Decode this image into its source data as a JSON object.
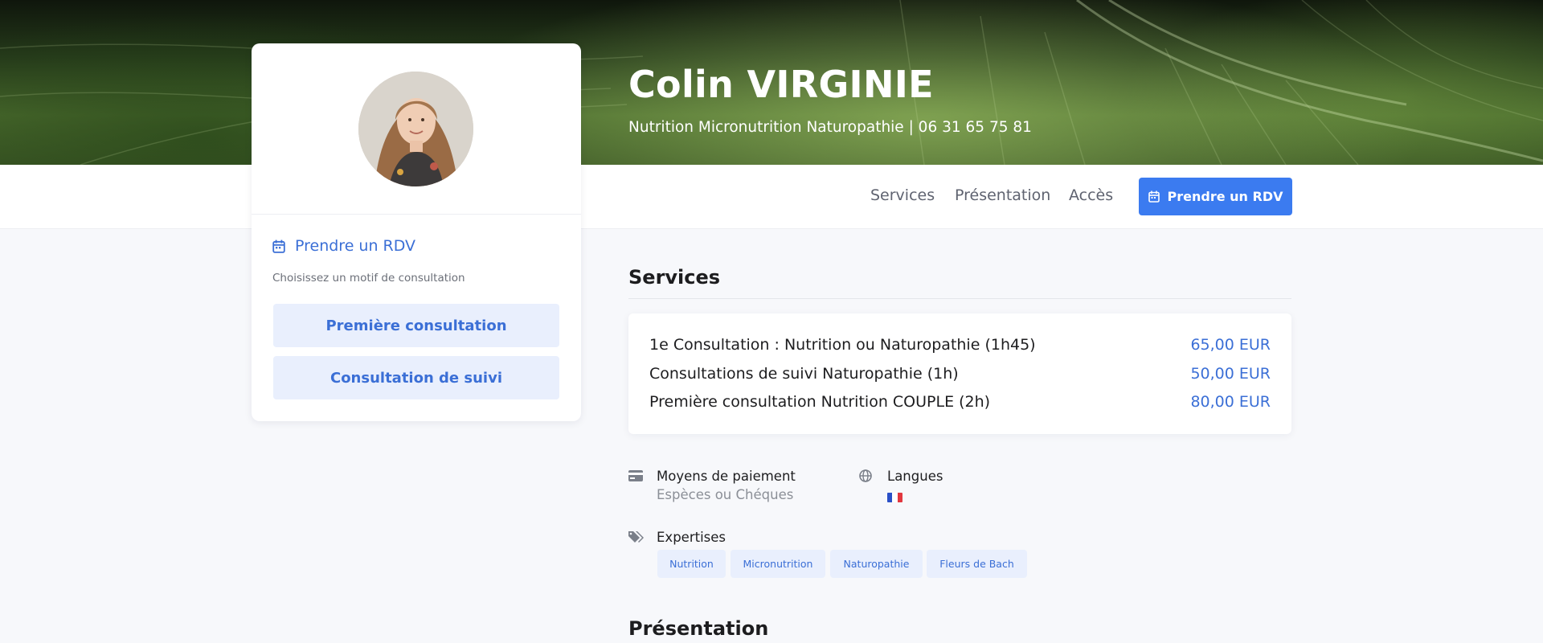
{
  "header": {
    "name": "Colin VIRGINIE",
    "subtitle": "Nutrition Micronutrition Naturopathie | 06 31 65 75 81"
  },
  "nav": {
    "items": [
      "Services",
      "Présentation",
      "Accès"
    ],
    "cta_label": "Prendre un RDV"
  },
  "booking_card": {
    "title": "Prendre un RDV",
    "hint": "Choisissez un motif de consultation",
    "motifs": [
      "Première consultation",
      "Consultation de suivi"
    ]
  },
  "services": {
    "title": "Services",
    "items": [
      {
        "name": "1e Consultation : Nutrition ou Naturopathie (1h45)",
        "price": "65,00 EUR"
      },
      {
        "name": "Consultations de suivi Naturopathie (1h)",
        "price": "50,00 EUR"
      },
      {
        "name": "Première consultation Nutrition COUPLE (2h)",
        "price": "80,00 EUR"
      }
    ]
  },
  "info": {
    "payment_label": "Moyens de paiement",
    "payment_value": "Espèces ou Chéques",
    "languages_label": "Langues",
    "expertises_label": "Expertises",
    "expertises": [
      "Nutrition",
      "Micronutrition",
      "Naturopathie",
      "Fleurs de Bach"
    ]
  },
  "presentation": {
    "title": "Présentation"
  },
  "colors": {
    "accent": "#3b7bf0",
    "link": "#3b6fd6",
    "tag_bg": "#e9effd"
  },
  "icons": [
    "calendar-icon",
    "credit-card-icon",
    "globe-icon",
    "tags-icon",
    "flag-fr-icon"
  ]
}
